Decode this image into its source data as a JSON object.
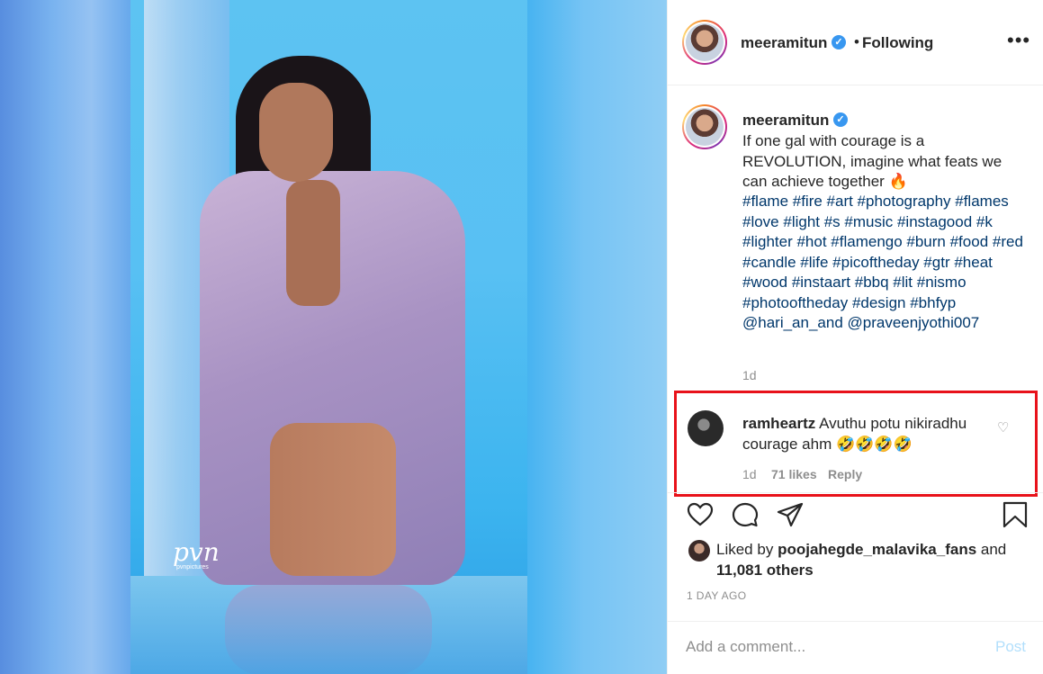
{
  "post": {
    "username": "meeramitun",
    "follow_dot": "•",
    "follow_status": "Following",
    "more_icon": "more-horizontal-icon"
  },
  "photo": {
    "watermark": "pvn",
    "watermark_sub": "pvnpictures"
  },
  "caption": {
    "username": "meeramitun",
    "text": "If one gal with courage is a REVOLUTION, imagine what feats we can achieve together 🔥",
    "hashtags": "#flame #fire #art #photography #flames #love #light #s #music #instagood #k #lighter #hot #flamengo #burn #food #red #candle #life #picoftheday #gtr #heat #wood #instaart #bbq #lit #nismo #photooftheday #design #bhfyp @hari_an_and @praveenjyothi007",
    "time": "1d"
  },
  "comment": {
    "username": "ramheartz",
    "text": "Avuthu potu nikiradhu courage ahm 🤣🤣🤣🤣",
    "time": "1d",
    "likes": "71 likes",
    "reply": "Reply",
    "highlight_color": "#e8121a"
  },
  "actions": {
    "like_icon": "heart-icon",
    "comment_icon": "comment-icon",
    "share_icon": "send-icon",
    "save_icon": "bookmark-icon"
  },
  "likes": {
    "prefix": "Liked by",
    "user": "poojahegde_malavika_fans",
    "and": "and",
    "count": "11,081 others"
  },
  "posted": "1 DAY AGO",
  "add_comment": {
    "placeholder": "Add a comment...",
    "post_label": "Post"
  },
  "colors": {
    "link": "#00376b",
    "muted": "#8e8e8e",
    "verified": "#3897f0",
    "post_disabled": "#b2dffc"
  }
}
